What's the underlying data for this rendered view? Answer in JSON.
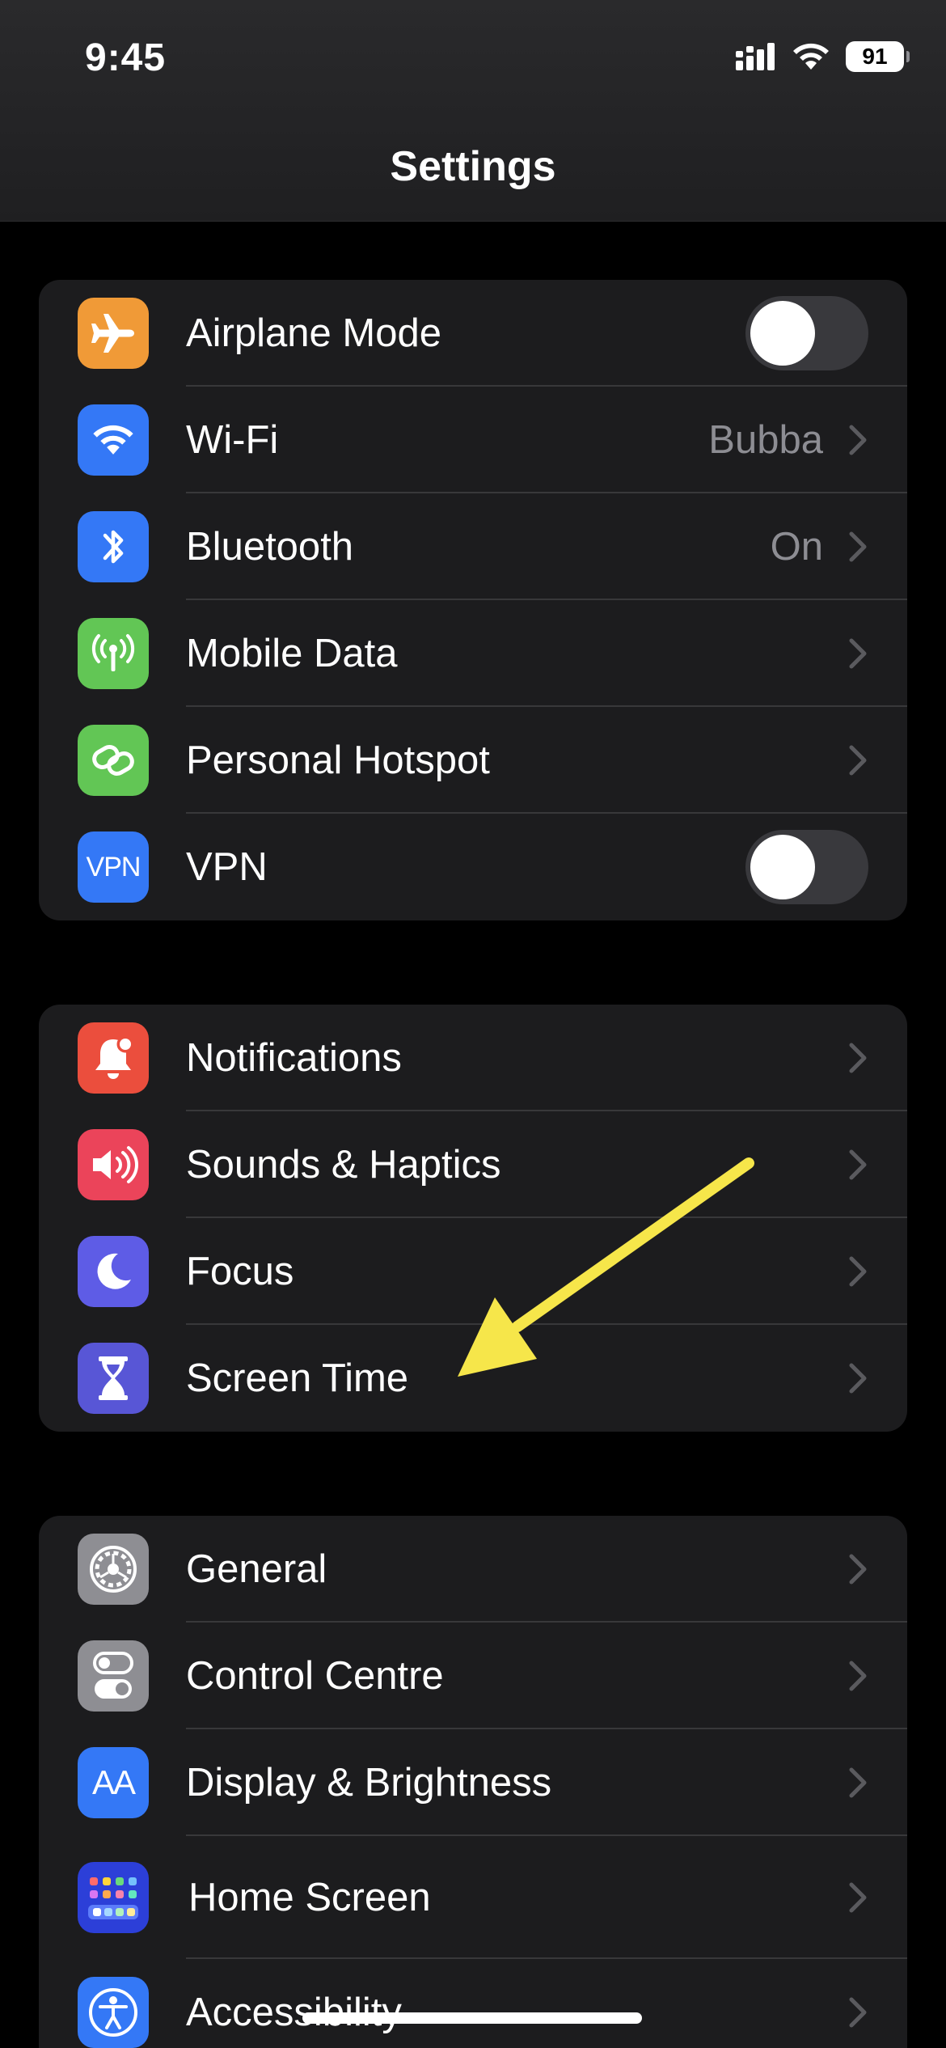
{
  "status_bar": {
    "time": "9:45",
    "battery": "91"
  },
  "nav": {
    "title": "Settings"
  },
  "colors": {
    "orange": "#f09a37",
    "blue": "#3478f6",
    "green": "#62c655",
    "red": "#eb4e3d",
    "pink": "#eb445a",
    "indigo": "#5e5ce6",
    "purple": "#5856d6",
    "gray": "#8e8e93",
    "annotation_yellow": "#f6e64a"
  },
  "groups": [
    {
      "rows": [
        {
          "label": "Airplane Mode",
          "icon": "airplane-icon",
          "accessory": "toggle",
          "on": false
        },
        {
          "label": "Wi-Fi",
          "icon": "wifi-icon",
          "value": "Bubba",
          "accessory": "chevron"
        },
        {
          "label": "Bluetooth",
          "icon": "bluetooth-icon",
          "value": "On",
          "accessory": "chevron"
        },
        {
          "label": "Mobile Data",
          "icon": "antenna-icon",
          "accessory": "chevron"
        },
        {
          "label": "Personal Hotspot",
          "icon": "hotspot-link-icon",
          "accessory": "chevron"
        },
        {
          "label": "VPN",
          "icon": "vpn-icon",
          "icon_text": "VPN",
          "accessory": "toggle",
          "on": false
        }
      ]
    },
    {
      "rows": [
        {
          "label": "Notifications",
          "icon": "bell-icon",
          "accessory": "chevron"
        },
        {
          "label": "Sounds & Haptics",
          "icon": "speaker-icon",
          "accessory": "chevron"
        },
        {
          "label": "Focus",
          "icon": "moon-icon",
          "accessory": "chevron"
        },
        {
          "label": "Screen Time",
          "icon": "hourglass-icon",
          "accessory": "chevron"
        }
      ]
    },
    {
      "rows": [
        {
          "label": "General",
          "icon": "gear-icon",
          "accessory": "chevron"
        },
        {
          "label": "Control Centre",
          "icon": "switches-icon",
          "accessory": "chevron"
        },
        {
          "label": "Display & Brightness",
          "icon": "text-size-icon",
          "icon_text": "AA",
          "accessory": "chevron"
        },
        {
          "label": "Home Screen",
          "icon": "app-grid-icon",
          "accessory": "chevron"
        },
        {
          "label": "Accessibility",
          "icon": "accessibility-icon",
          "accessory": "chevron"
        }
      ]
    }
  ]
}
